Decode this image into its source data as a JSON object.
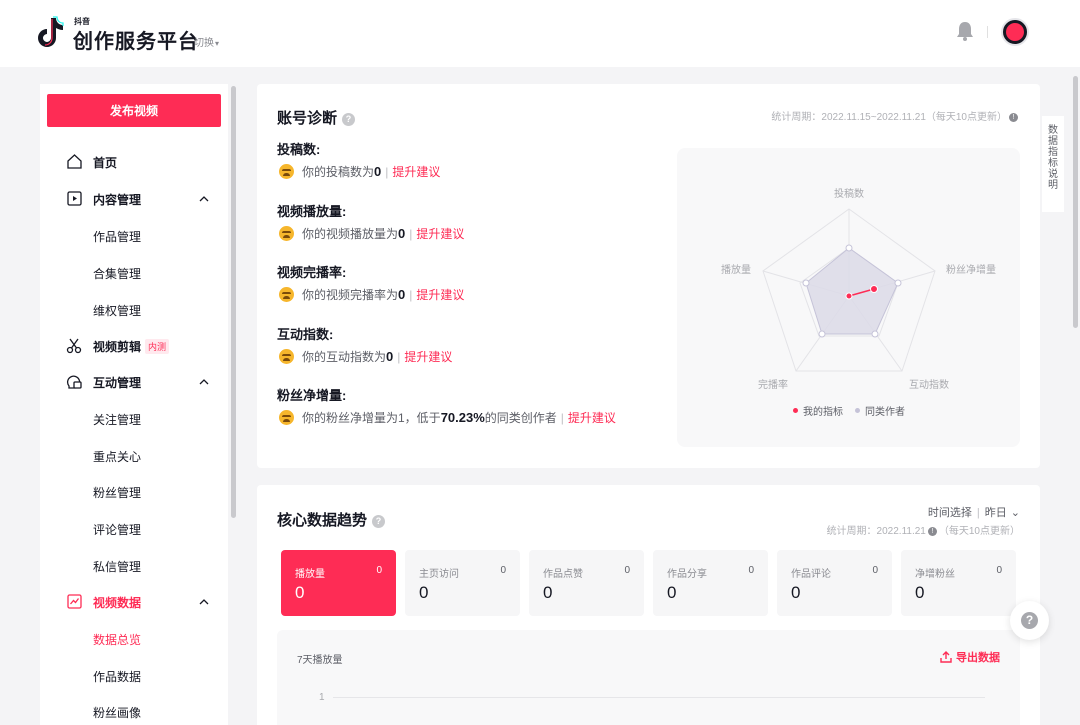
{
  "header": {
    "logo_small": "抖音",
    "logo_main": "创作服务平台",
    "switch_label": "切换"
  },
  "sidebar": {
    "publish_label": "发布视频",
    "home": "首页",
    "content_mgmt": "内容管理",
    "works_mgmt": "作品管理",
    "collection_mgmt": "合集管理",
    "rights_mgmt": "维权管理",
    "video_edit": "视频剪辑",
    "video_edit_tag": "内测",
    "interaction_mgmt": "互动管理",
    "follow_mgmt": "关注管理",
    "key_care": "重点关心",
    "fans_mgmt": "粉丝管理",
    "comment_mgmt": "评论管理",
    "dm_mgmt": "私信管理",
    "video_data": "视频数据",
    "data_overview": "数据总览",
    "works_data": "作品数据",
    "fans_portrait": "粉丝画像"
  },
  "diagnosis": {
    "title": "账号诊断",
    "period": "统计周期：2022.11.15~2022.11.21（每天10点更新）",
    "metrics": [
      {
        "title": "投稿数:",
        "prefix": "你的投稿数为",
        "value": "0",
        "suffix": "",
        "link": "提升建议"
      },
      {
        "title": "视频播放量:",
        "prefix": "你的视频播放量为",
        "value": "0",
        "suffix": "",
        "link": "提升建议"
      },
      {
        "title": "视频完播率:",
        "prefix": "你的视频完播率为",
        "value": "0",
        "suffix": "",
        "link": "提升建议"
      },
      {
        "title": "互动指数:",
        "prefix": "你的互动指数为",
        "value": "0",
        "suffix": "",
        "link": "提升建议"
      },
      {
        "title": "粉丝净增量:",
        "prefix": "你的粉丝净增量为1，低于",
        "value": "70.23%",
        "suffix": "的同类创作者",
        "link": "提升建议"
      }
    ],
    "radar": {
      "axes": [
        "投稿数",
        "粉丝净增量",
        "互动指数",
        "完播率",
        "播放量"
      ],
      "legend_mine": "我的指标",
      "legend_peer": "同类作者",
      "color_mine": "#fe2c55",
      "color_peer": "#c5c3d8"
    }
  },
  "side_tab": {
    "label": "数据指标说明"
  },
  "trend": {
    "title": "核心数据趋势",
    "time_label": "时间选择",
    "time_value": "昨日",
    "period": "统计周期：2022.11.21",
    "period_note": "（每天10点更新）",
    "stats": [
      {
        "label": "播放量",
        "small": "0",
        "value": "0"
      },
      {
        "label": "主页访问",
        "small": "0",
        "value": "0"
      },
      {
        "label": "作品点赞",
        "small": "0",
        "value": "0"
      },
      {
        "label": "作品分享",
        "small": "0",
        "value": "0"
      },
      {
        "label": "作品评论",
        "small": "0",
        "value": "0"
      },
      {
        "label": "净增粉丝",
        "small": "0",
        "value": "0"
      }
    ],
    "chart_title": "7天播放量",
    "export_label": "导出数据",
    "y_tick": "1"
  },
  "colors": {
    "accent": "#fe2c55"
  }
}
